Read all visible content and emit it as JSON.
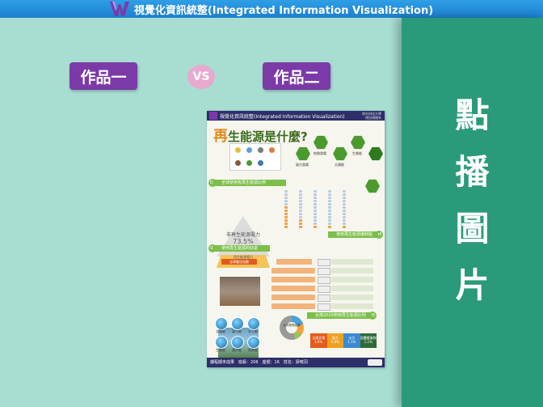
{
  "window": {
    "title": "視覺化資訊統整(Integrated Information Visualization)",
    "logo_icon": "purple-w-logo"
  },
  "slide": {
    "label_left": "作品一",
    "vs_badge": "VS",
    "label_right": "作品二",
    "side_panel_chars": [
      "點",
      "播",
      "圖",
      "片"
    ],
    "colors": {
      "background": "#a8ded2",
      "side_panel": "#2a9a7a",
      "label_box": "#7b3aa8",
      "vs_badge": "#e7a9cf",
      "top_bar": "#2f9fe6"
    }
  },
  "poster": {
    "header": "視覺化資訊統整(Integrated Information Visualization)",
    "org_line1": "南台科技大學",
    "org_line2": "視訊傳播系",
    "title_first": "再",
    "title_rest": "生能源是什麼?",
    "sections": [
      {
        "num": "01",
        "label": "全球使用各再生能源比例"
      },
      {
        "num": "02",
        "label": "使用再生能源的好處"
      },
      {
        "num": "04",
        "label": "使用再生能源優缺點"
      },
      {
        "num": "05",
        "label": "台灣2020使用再生能源比例"
      }
    ],
    "pyramid_top_label": "非再生能源電力",
    "pyramid_top_value": "73.5%",
    "pyramid_bottom_label": "再生能源電力",
    "pyramid_bottom_value": "26.5%",
    "highlight_label": "全球暖化加劇",
    "hex_labels": [
      "風力發電",
      "地熱發電",
      "太陽能",
      "生質能"
    ],
    "ball_labels": [
      "太陽能",
      "風力能",
      "水力能",
      "生質能",
      "潮汐能",
      "地熱能"
    ],
    "donut_label": "台灣發電結構",
    "table_cells": [
      "太陽光電",
      "風力",
      "水力",
      "固體廢棄物"
    ],
    "table_values": [
      "3.6%",
      "0.8%",
      "1.1%",
      "1.1%"
    ],
    "footer": "課程期末成果　班級：206　座號：16　姓名：廖曉羽"
  }
}
